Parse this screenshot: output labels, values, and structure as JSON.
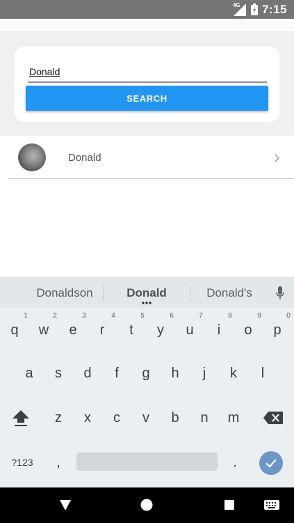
{
  "status_bar": {
    "time": "7:15",
    "network": "4G",
    "icons": [
      "signal-icon",
      "battery-icon"
    ]
  },
  "search": {
    "value": "Donald",
    "button_label": "SEARCH"
  },
  "results": [
    {
      "name": "Donald"
    }
  ],
  "keyboard": {
    "suggestions": [
      "Donaldson",
      "Donald",
      "Donald's"
    ],
    "row1": [
      "q",
      "w",
      "e",
      "r",
      "t",
      "y",
      "u",
      "i",
      "o",
      "p"
    ],
    "row1_hints": [
      "1",
      "2",
      "3",
      "4",
      "5",
      "6",
      "7",
      "8",
      "9",
      "0"
    ],
    "row2": [
      "a",
      "s",
      "d",
      "f",
      "g",
      "h",
      "j",
      "k",
      "l"
    ],
    "row3": [
      "z",
      "x",
      "c",
      "v",
      "b",
      "n",
      "m"
    ],
    "symbols_label": "?123",
    "comma": ",",
    "period": "."
  },
  "colors": {
    "accent": "#2196f3",
    "status_bar": "#757575",
    "keyboard_bg": "#eceff1",
    "enter_key": "#6a96c8"
  },
  "nav_icons": [
    "back-icon",
    "home-icon",
    "recents-icon",
    "keyboard-switch-icon"
  ]
}
